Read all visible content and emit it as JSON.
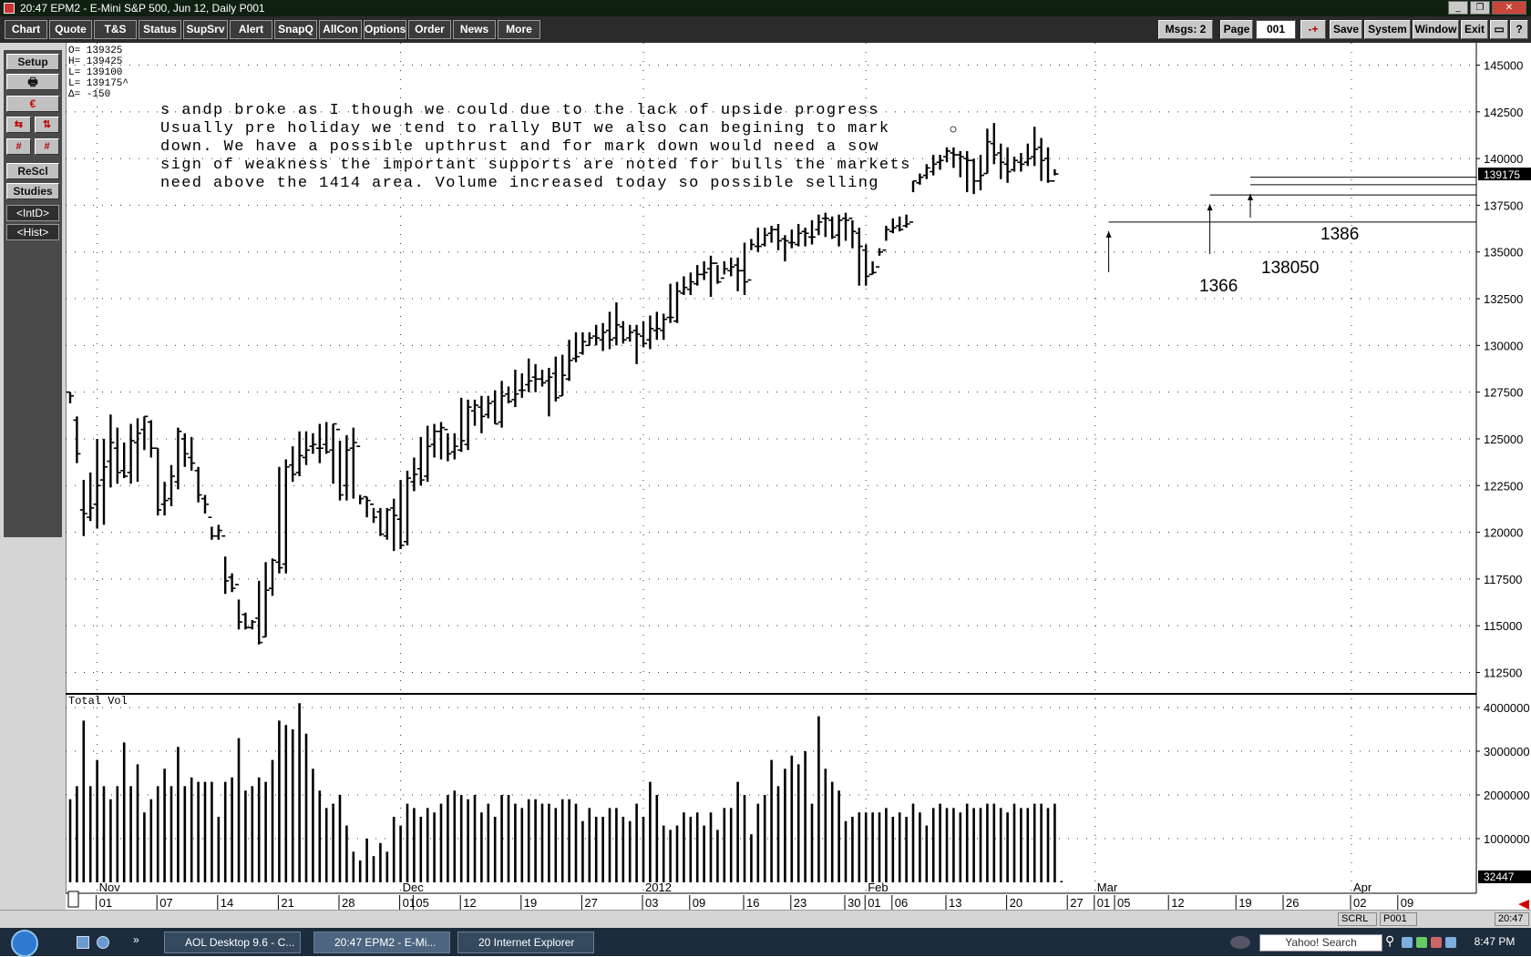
{
  "window": {
    "title": "20:47  EPM2 - E-Mini S&P 500, Jun 12, Daily  P001",
    "min_glyph": "_",
    "restore_glyph": "❐",
    "close_glyph": "✕"
  },
  "toolbar": {
    "left_buttons": [
      "Chart",
      "Quote",
      "T&S",
      "Status",
      "SupSrv",
      "Alert",
      "SnapQ",
      "AllCon",
      "Options",
      "Order",
      "News",
      "More"
    ],
    "msgs_label": "Msgs: 2",
    "page_label": "Page",
    "page_value": "001",
    "page_step": "-+",
    "save_label": "Save",
    "system_label": "System",
    "window_label": "Window",
    "exit_label": "Exit",
    "help_label": "?"
  },
  "sidebar": {
    "setup_label": "Setup",
    "print_glyph": "🖶",
    "rescale_label": "ReScl",
    "studies_label": "Studies",
    "intd_label": "<IntD>",
    "hist_label": "<Hist>"
  },
  "readout": {
    "o": "O= 139325",
    "h": "H= 139425",
    "l": "L= 139100",
    "last": "L= 139175^",
    "delta": "Δ=    -150"
  },
  "annotation_lines": [
    "s andp broke as I though we could due to the lack of upside progress",
    "Usually pre holiday we tend to rally BUT we also can begining to mark",
    "down. We have a possible upthrust and for mark down would need a sow",
    "sign of weakness the important supports are noted for bulls the markets",
    "need above the 1414 area. Volume increased today so possible selling"
  ],
  "marker_labels": [
    "1366",
    "138050",
    "1386"
  ],
  "vol_label": "Total Vol",
  "status": {
    "scrl": "SCRL",
    "page": "P001",
    "time": "20:47"
  },
  "taskbar": {
    "items": [
      "AOL Desktop 9.6 - C...",
      "20:47  EPM2 - E-Mi...",
      "20 Internet Explorer"
    ],
    "search_placeholder": "Yahoo! Search",
    "clock": "8:47 PM"
  },
  "colors": {
    "titlebar": "#0f1f10",
    "toolbar": "#2b2b2b",
    "price_bars": "#000000",
    "alert_arrow": "#d40000",
    "last_price_tag": "#000000"
  },
  "chart_data": [
    {
      "type": "bar",
      "ohlc": true,
      "title": "EPM2 - E-Mini S&P 500, Jun 12, Daily",
      "ylim": [
        111500,
        146000
      ],
      "y_ticks": [
        112500,
        115000,
        117500,
        120000,
        122500,
        125000,
        127500,
        130000,
        132500,
        135000,
        137500,
        140000,
        142500,
        145000
      ],
      "y_tick_labels": [
        "112500",
        "115000",
        "117500",
        "120000",
        "122500",
        "125000",
        "127500",
        "130000",
        "132500",
        "135000",
        "137500",
        "140000",
        "142500",
        "145000"
      ],
      "last_price": 139175,
      "last_price_label": "139175",
      "x_labels": [
        "Nov",
        "01",
        "07",
        "14",
        "21",
        "28",
        "Dec",
        "01",
        "05",
        "12",
        "19",
        "27",
        "2012",
        "03",
        "09",
        "16",
        "23",
        "30",
        "Feb",
        "01",
        "06",
        "13",
        "20",
        "27",
        "Mar",
        "01",
        "05",
        "12",
        "19",
        "26",
        "Apr",
        "02",
        "09"
      ],
      "x_label_bars": [
        4,
        4,
        13,
        22,
        31,
        40,
        49,
        49,
        51,
        58,
        67,
        76,
        85,
        85,
        92,
        100,
        107,
        115,
        118,
        118,
        122,
        130,
        139,
        148,
        152,
        152,
        155,
        163,
        173,
        180,
        190,
        190,
        197
      ],
      "x_label_months": [
        true,
        false,
        false,
        false,
        false,
        false,
        true,
        false,
        false,
        false,
        false,
        false,
        true,
        false,
        false,
        false,
        false,
        false,
        true,
        false,
        false,
        false,
        false,
        false,
        true,
        false,
        false,
        false,
        false,
        false,
        true,
        false,
        false
      ],
      "bar_spacing": 7.4,
      "close": [
        127300,
        124200,
        121000,
        121300,
        122500,
        123500,
        124800,
        123200,
        123000,
        124900,
        125300,
        126200,
        124500,
        121200,
        121700,
        123000,
        125400,
        124200,
        123700,
        122000,
        121500,
        119800,
        120100,
        117400,
        117000,
        115200,
        114900,
        115200,
        114100,
        116900,
        118500,
        118100,
        123500,
        123100,
        124100,
        124400,
        124700,
        124500,
        124300,
        125800,
        122000,
        124400,
        124800,
        121800,
        121700,
        120800,
        119900,
        121200,
        120900,
        119300,
        122900,
        123100,
        122800,
        124600,
        125400,
        125600,
        124200,
        124600,
        124900,
        126700,
        126800,
        126200,
        126900,
        125800,
        127300,
        127000,
        127400,
        127600,
        128100,
        128200,
        128000,
        128300,
        127200,
        128400,
        129200,
        129400,
        130200,
        130400,
        130400,
        130700,
        130300,
        131100,
        130300,
        130700,
        130600,
        130100,
        130900,
        130900,
        131400,
        131500,
        132900,
        133100,
        133400,
        133800,
        133900,
        134400,
        133400,
        134100,
        134200,
        134000,
        133400,
        135400,
        135300,
        135900,
        136200,
        135600,
        135600,
        135500,
        136000,
        136000,
        135800,
        136600,
        136800,
        135800,
        136700,
        136700,
        136100,
        135300,
        133700,
        133900,
        135000,
        136200,
        136300,
        136200,
        136500,
        138800,
        139000,
        139500,
        139700,
        139900,
        140400,
        140200,
        140100,
        139900,
        138800,
        139100,
        140900,
        140200,
        139800,
        139300,
        139900,
        139700,
        140000,
        140500,
        139900,
        138800,
        139175
      ],
      "open": [
        127500,
        126000,
        121200,
        120800,
        121500,
        122800,
        123800,
        124500,
        123300,
        123200,
        124800,
        125500,
        125900,
        124500,
        121500,
        121800,
        122700,
        125000,
        124000,
        123300,
        121800,
        120800,
        119800,
        119800,
        117600,
        117200,
        115600,
        114900,
        115400,
        114400,
        117000,
        118400,
        118300,
        123600,
        123200,
        124000,
        124600,
        124500,
        124700,
        124400,
        125500,
        122500,
        124500,
        124600,
        121900,
        121500,
        121100,
        119800,
        121300,
        120700,
        119500,
        122700,
        123400,
        123000,
        124700,
        125400,
        125500,
        124300,
        124400,
        124700,
        126500,
        126700,
        126300,
        127000,
        125900,
        127400,
        127100,
        127600,
        127900,
        128300,
        128200,
        128100,
        128500,
        127300,
        128200,
        129300,
        129600,
        130000,
        130500,
        130300,
        130800,
        130400,
        131000,
        130400,
        130800,
        130500,
        130300,
        130800,
        130800,
        131500,
        131300,
        132800,
        133000,
        133300,
        133800,
        134100,
        134400,
        133600,
        134000,
        134300,
        134000,
        133500,
        135300,
        135400,
        136000,
        136200,
        135700,
        135500,
        135400,
        136100,
        135800,
        136200,
        136800,
        136700,
        135900,
        136800,
        136800,
        136000,
        135100,
        133800,
        134200,
        135100,
        136100,
        136400,
        136400,
        136600,
        138700,
        139100,
        139300,
        139800,
        140100,
        140300,
        140200,
        140000,
        139900,
        138800,
        139200,
        140800,
        140300,
        139700,
        139400,
        139800,
        139800,
        140100,
        140600,
        140000,
        138800,
        139325
      ],
      "high": [
        127500,
        126200,
        122800,
        123200,
        125000,
        125000,
        126300,
        125600,
        124800,
        125800,
        126100,
        126200,
        126000,
        124500,
        122700,
        123600,
        125600,
        125300,
        125100,
        123500,
        122000,
        120300,
        120400,
        118700,
        117800,
        116400,
        115700,
        115300,
        117400,
        118400,
        118600,
        123500,
        123900,
        124600,
        125400,
        125400,
        125300,
        125800,
        125900,
        125800,
        124900,
        125200,
        125600,
        122000,
        121900,
        121300,
        121300,
        121300,
        121800,
        122800,
        123300,
        124000,
        125100,
        125700,
        125800,
        125900,
        125300,
        125300,
        127200,
        127100,
        127100,
        127300,
        127300,
        127600,
        128100,
        127800,
        128700,
        128500,
        129300,
        129000,
        128700,
        128800,
        129400,
        129500,
        130300,
        130700,
        130700,
        130700,
        131100,
        131200,
        131800,
        132300,
        131300,
        131100,
        131100,
        131300,
        131600,
        131800,
        131700,
        133300,
        133400,
        133700,
        133900,
        134300,
        134500,
        134800,
        134300,
        134500,
        134700,
        134700,
        135500,
        135700,
        136300,
        136300,
        136400,
        136500,
        135900,
        136200,
        136500,
        136300,
        136700,
        137000,
        137100,
        136900,
        137000,
        137100,
        136700,
        136300,
        135400,
        134500,
        135200,
        136400,
        136800,
        136900,
        137000,
        138800,
        139200,
        139700,
        140200,
        140200,
        140600,
        140600,
        140400,
        140400,
        140000,
        140200,
        141600,
        141900,
        140800,
        140600,
        140100,
        140300,
        140800,
        141700,
        141100,
        140600,
        139425
      ],
      "low": [
        126900,
        123700,
        119800,
        120600,
        120200,
        120400,
        122400,
        122600,
        122900,
        122600,
        122700,
        124400,
        124000,
        120900,
        120900,
        121400,
        122300,
        123500,
        123300,
        121600,
        121000,
        119600,
        119600,
        116700,
        116800,
        114800,
        114800,
        114800,
        114000,
        114400,
        116600,
        117800,
        117800,
        122700,
        123000,
        123600,
        124200,
        123700,
        124200,
        122600,
        121700,
        121700,
        121800,
        121500,
        120800,
        120500,
        119800,
        119600,
        119000,
        119100,
        119300,
        122200,
        122500,
        122700,
        124000,
        123900,
        123800,
        123900,
        124300,
        124400,
        125700,
        125300,
        126100,
        125800,
        125600,
        126900,
        126700,
        127200,
        127500,
        127500,
        127800,
        126200,
        127000,
        127300,
        128100,
        129100,
        129500,
        130000,
        130000,
        129700,
        129800,
        130000,
        130100,
        130200,
        129000,
        129900,
        129800,
        130300,
        130300,
        131200,
        131200,
        132700,
        132700,
        133200,
        133500,
        132600,
        133300,
        133800,
        133700,
        132900,
        132700,
        135100,
        135000,
        135300,
        135500,
        135100,
        134500,
        135200,
        135300,
        135300,
        135400,
        135900,
        135800,
        135700,
        135300,
        135600,
        135200,
        133200,
        133200,
        133800,
        134800,
        135600,
        136000,
        136100,
        136300,
        138200,
        138600,
        138900,
        139100,
        139400,
        139800,
        139500,
        139000,
        138200,
        138100,
        138300,
        139200,
        139700,
        138900,
        138700,
        139300,
        139300,
        139600,
        139600,
        138800,
        138700,
        139100
      ],
      "support_levels": [
        136600,
        138050,
        138600,
        139000
      ],
      "marker_bars": [
        154,
        169,
        175
      ]
    },
    {
      "type": "bar",
      "title": "Total Vol",
      "ylim": [
        0,
        4250000
      ],
      "y_ticks": [
        1000000,
        2000000,
        3000000,
        4000000
      ],
      "y_tick_labels": [
        "1000000",
        "2000000",
        "3000000",
        "4000000"
      ],
      "last_value_label": "32447",
      "values": [
        1900000,
        2200000,
        3700000,
        2200000,
        2800000,
        2200000,
        1900000,
        2200000,
        3200000,
        2200000,
        2700000,
        1600000,
        1900000,
        2200000,
        2600000,
        2200000,
        3100000,
        2200000,
        2400000,
        2300000,
        2300000,
        2300000,
        1500000,
        2300000,
        2400000,
        3300000,
        2100000,
        2200000,
        2400000,
        2300000,
        2800000,
        3700000,
        3600000,
        3500000,
        4100000,
        3400000,
        2600000,
        2100000,
        1700000,
        1800000,
        2000000,
        1300000,
        700000,
        500000,
        1000000,
        600000,
        900000,
        700000,
        1500000,
        1300000,
        1800000,
        1700000,
        1500000,
        1700000,
        1600000,
        1800000,
        2000000,
        2100000,
        2000000,
        1900000,
        2000000,
        1600000,
        1800000,
        1500000,
        2000000,
        2000000,
        1800000,
        1700000,
        1900000,
        1900000,
        1800000,
        1800000,
        1700000,
        1900000,
        1900000,
        1800000,
        1400000,
        1700000,
        1500000,
        1500000,
        1700000,
        1700000,
        1500000,
        1400000,
        1800000,
        1500000,
        2300000,
        2000000,
        1300000,
        1200000,
        1300000,
        1600000,
        1500000,
        1600000,
        1300000,
        1600000,
        1200000,
        1700000,
        1700000,
        2300000,
        2000000,
        1100000,
        1800000,
        2000000,
        2800000,
        2200000,
        2600000,
        2900000,
        2700000,
        3000000,
        1800000,
        3800000,
        2600000,
        2300000,
        2100000,
        1400000,
        1500000,
        1600000,
        1600000,
        1600000,
        1600000,
        1700000,
        1500000,
        1600000,
        1500000,
        1800000,
        1600000,
        1300000,
        1700000,
        1800000,
        1700000,
        1700000,
        1600000,
        1800000,
        1700000,
        1700000,
        1800000,
        1800000,
        1700000,
        1600000,
        1800000,
        1700000,
        1700000,
        1800000,
        1800000,
        1700000,
        1800000,
        32447
      ]
    }
  ]
}
